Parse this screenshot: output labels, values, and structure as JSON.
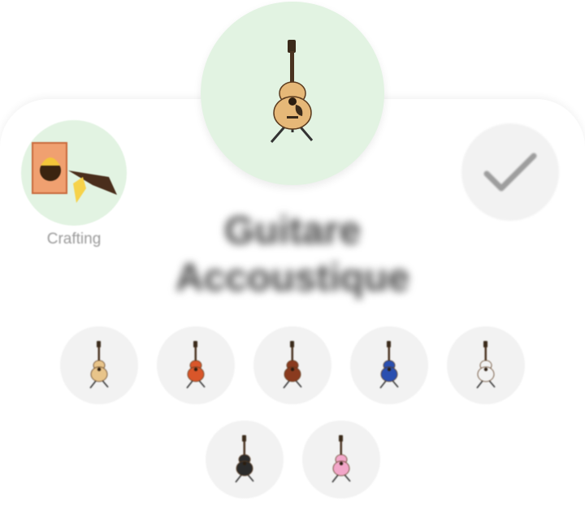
{
  "category": {
    "label": "Crafting",
    "icon": "crafting-icon"
  },
  "item": {
    "title": "Guitare Accoustique",
    "icon": "acoustic-guitar-icon",
    "selected_color": "#e8c48a"
  },
  "confirm": {
    "icon": "checkmark-icon"
  },
  "variants": [
    {
      "color": "#e8c48a"
    },
    {
      "color": "#d9562a"
    },
    {
      "color": "#8a3b1f"
    },
    {
      "color": "#2a4fb0"
    },
    {
      "color": "#f2f2f2"
    },
    {
      "color": "#2b2b2b"
    },
    {
      "color": "#f2a7c9"
    }
  ],
  "colors": {
    "hero_bg": "#e2f3e2",
    "variant_bg": "#f2f2f2",
    "label": "#9a9a9a"
  }
}
